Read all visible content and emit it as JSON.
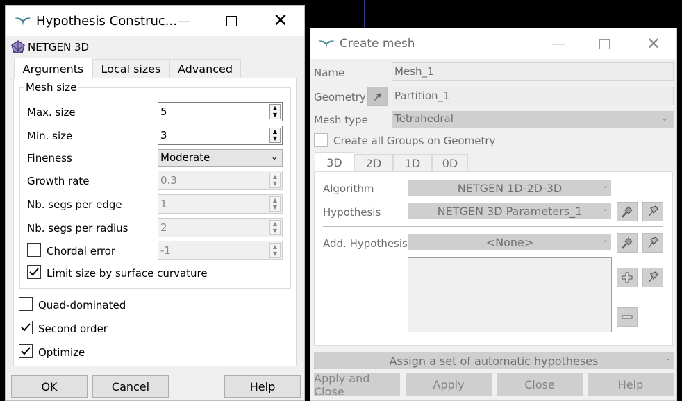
{
  "hypothesis_dialog": {
    "title": "Hypothesis Construc...",
    "algorithm_name": "NETGEN 3D",
    "tabs": [
      "Arguments",
      "Local sizes",
      "Advanced"
    ],
    "group_title": "Mesh size",
    "fields": {
      "max_size": {
        "label": "Max. size",
        "value": "5"
      },
      "min_size": {
        "label": "Min. size",
        "value": "3"
      },
      "fineness": {
        "label": "Fineness",
        "value": "Moderate"
      },
      "growth_rate": {
        "label": "Growth rate",
        "value": "0.3"
      },
      "segs_per_edge": {
        "label": "Nb. segs per edge",
        "value": "1"
      },
      "segs_per_radius": {
        "label": "Nb. segs per radius",
        "value": "2"
      },
      "chordal_error": {
        "label": "Chordal error",
        "value": "-1",
        "checked": false
      },
      "limit_size": {
        "label": "Limit size by surface curvature",
        "checked": true
      }
    },
    "quad_dominated": {
      "label": "Quad-dominated",
      "checked": false
    },
    "second_order": {
      "label": "Second order",
      "checked": true
    },
    "optimize": {
      "label": "Optimize",
      "checked": true
    },
    "buttons": {
      "ok": "OK",
      "cancel": "Cancel",
      "help": "Help"
    }
  },
  "create_mesh_dialog": {
    "title": "Create mesh",
    "name_label": "Name",
    "name_value": "Mesh_1",
    "geometry_label": "Geometry",
    "geometry_value": "Partition_1",
    "mesh_type_label": "Mesh type",
    "mesh_type_value": "Tetrahedral",
    "create_groups_label": "Create all Groups on Geometry",
    "dim_tabs": [
      "3D",
      "2D",
      "1D",
      "0D"
    ],
    "algorithm_label": "Algorithm",
    "algorithm_value": "NETGEN 1D-2D-3D",
    "hypothesis_label": "Hypothesis",
    "hypothesis_value": "NETGEN 3D Parameters_1",
    "add_hypothesis_label": "Add. Hypothesis",
    "add_hypothesis_value": "<None>",
    "assign_set_label": "Assign a set of automatic hypotheses",
    "buttons": {
      "apply_close": "Apply and Close",
      "apply": "Apply",
      "close": "Close",
      "help": "Help"
    }
  },
  "colors": {
    "titlebar": "#ffffff",
    "dialog_bg": "#f0f0f0",
    "disabled_field": "#cfcfcf",
    "background": "#000000"
  }
}
